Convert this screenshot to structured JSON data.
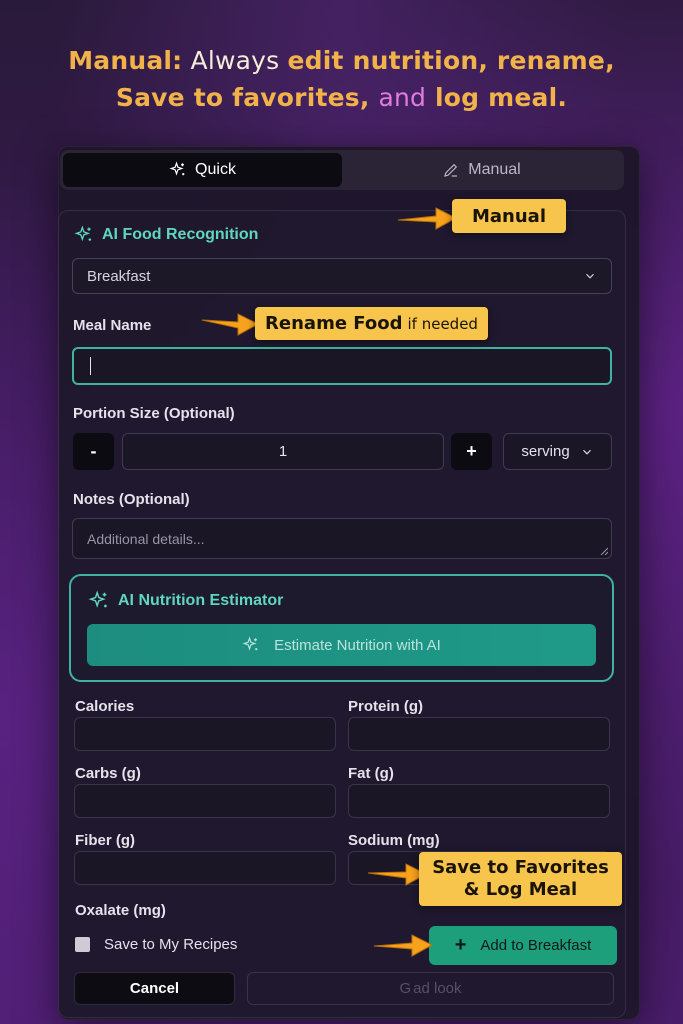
{
  "headline": {
    "line1_a": "Manual:",
    "line1_b": " Always ",
    "line1_c": "edit nutrition, rename,",
    "line2_a": "Save to favorites, ",
    "line2_b": "and",
    "line2_c": " log meal."
  },
  "tabs": [
    {
      "label": "Quick",
      "icon": "sparkle-icon",
      "active": true
    },
    {
      "label": "Manual",
      "icon": "pencil-icon",
      "active": false
    }
  ],
  "ai_recognition": {
    "title": "AI Food Recognition",
    "icon": "sparkle-icon"
  },
  "meal_type": {
    "selected": "Breakfast"
  },
  "meal_name": {
    "label": "Meal Name",
    "value": ""
  },
  "portion": {
    "label": "Portion Size (Optional)",
    "minus": "-",
    "value": "1",
    "plus": "+",
    "unit": "serving"
  },
  "notes": {
    "label": "Notes (Optional)",
    "placeholder": "Additional details..."
  },
  "estimator": {
    "title": "AI Nutrition Estimator",
    "button": "Estimate Nutrition with AI"
  },
  "nutrients": {
    "calories": "Calories",
    "protein": "Protein (g)",
    "carbs": "Carbs (g)",
    "fat": "Fat (g)",
    "fiber": "Fiber (g)",
    "sodium": "Sodium (mg)",
    "oxalate": "Oxalate (mg)"
  },
  "save_recipes": {
    "label": "Save to My Recipes",
    "checked": false
  },
  "add_button": {
    "plus": "+",
    "label": "Add to Breakfast"
  },
  "cancel_button": "Cancel",
  "disabled_button": {
    "g": "G",
    "label": "ad look"
  },
  "callouts": {
    "manual": "Manual",
    "rename": "Rename Food",
    "rename_small": "if needed",
    "save_line1": "Save to Favorites",
    "save_line2": "& Log Meal"
  },
  "colors": {
    "accent_teal": "#3fb3a0",
    "callout": "#f7c54b",
    "add_green": "#1e9f7c"
  }
}
